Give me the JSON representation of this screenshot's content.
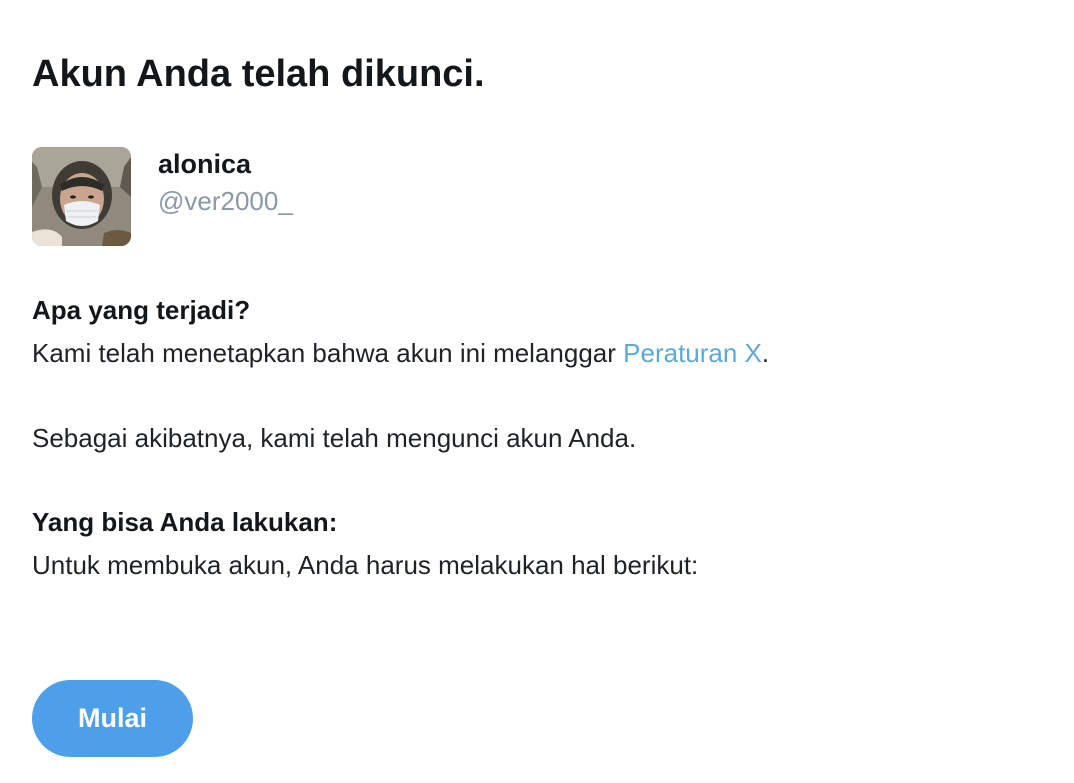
{
  "page": {
    "title": "Akun Anda telah dikunci."
  },
  "account": {
    "display_name": "alonica",
    "handle": "@ver2000_"
  },
  "what_happened": {
    "heading": "Apa yang terjadi?",
    "text_before_link": "Kami telah menetapkan bahwa akun ini melanggar ",
    "link_text": "Peraturan X",
    "text_after_link": ".",
    "consequence": "Sebagai akibatnya, kami telah mengunci akun Anda."
  },
  "what_to_do": {
    "heading": "Yang bisa Anda lakukan:",
    "text": "Untuk membuka akun, Anda harus melakukan hal berikut:"
  },
  "actions": {
    "start_label": "Mulai"
  },
  "colors": {
    "link": "#5ea8d8",
    "button": "#4d9fea",
    "handle": "#8b98a5"
  },
  "icons": {
    "avatar": "profile-photo"
  }
}
